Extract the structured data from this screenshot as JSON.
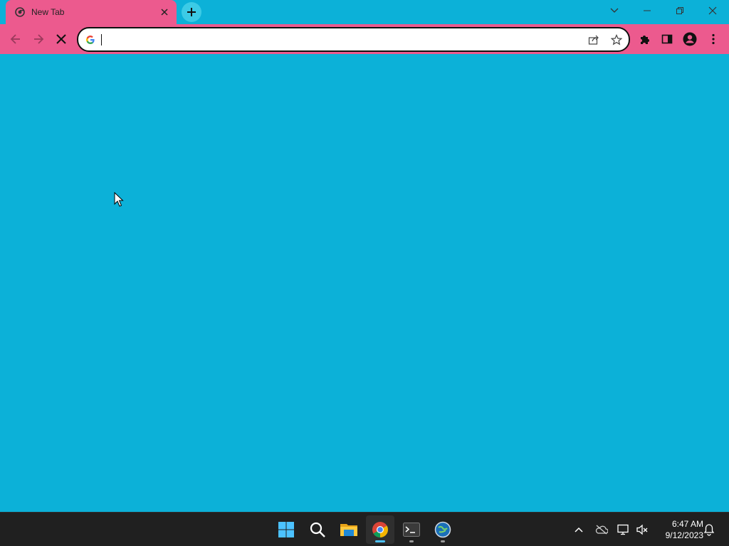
{
  "browser": {
    "tab": {
      "title": "New Tab",
      "favicon": "chrome-newtab-icon"
    },
    "window_controls": [
      "tab-search-icon",
      "minimize-icon",
      "restore-icon",
      "close-icon"
    ],
    "toolbar": {
      "back": "back-arrow-icon",
      "forward": "forward-arrow-icon",
      "stop": "stop-x-icon",
      "omnibox": {
        "value": "",
        "placeholder": ""
      },
      "omnibox_icons": [
        "share-icon",
        "bookmark-star-icon"
      ],
      "right_icons": [
        "extensions-puzzle-icon",
        "side-panel-icon",
        "profile-avatar-icon",
        "kebab-menu-icon"
      ]
    }
  },
  "content": {
    "background": "#0cb1d8"
  },
  "taskbar": {
    "apps": [
      "windows-start-icon",
      "search-icon",
      "file-explorer-icon",
      "chrome-icon",
      "terminal-icon",
      "app-globe-icon"
    ],
    "tray": [
      "chevron-up-icon",
      "onedrive-offline-icon",
      "network-icon",
      "volume-muted-icon",
      "notification-bell-icon"
    ],
    "clock": {
      "time": "6:47 AM",
      "date": "9/12/2023"
    }
  },
  "colors": {
    "accent_pink": "#ec5a8e",
    "page_cyan": "#0cb1d8",
    "taskbar_dark": "#202020"
  }
}
